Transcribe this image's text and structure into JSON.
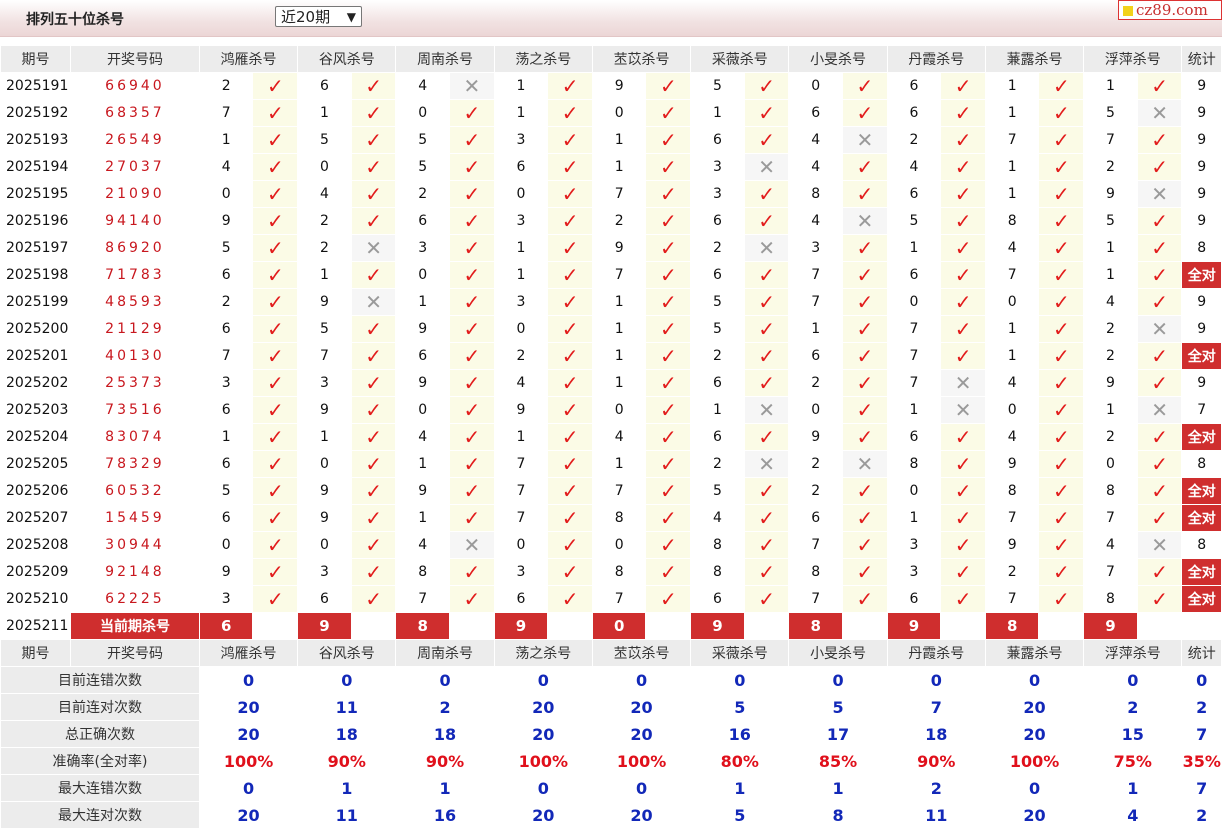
{
  "header": {
    "title": "排列五十位杀号",
    "period_select": "近20期",
    "logo_text": "cz89.com"
  },
  "columns": {
    "issue": "期号",
    "draw": "开奖号码",
    "experts": [
      "鸿雁杀号",
      "谷风杀号",
      "周南杀号",
      "荡之杀号",
      "苤苡杀号",
      "采薇杀号",
      "小旻杀号",
      "丹霞杀号",
      "蒹露杀号",
      "浮萍杀号"
    ],
    "count": "统计"
  },
  "rows": [
    {
      "issue": "2025191",
      "draw": "66940",
      "kills": [
        [
          2,
          1
        ],
        [
          6,
          1
        ],
        [
          4,
          0
        ],
        [
          1,
          1
        ],
        [
          9,
          1
        ],
        [
          5,
          1
        ],
        [
          0,
          1
        ],
        [
          6,
          1
        ],
        [
          1,
          1
        ],
        [
          1,
          1
        ]
      ],
      "count": "9"
    },
    {
      "issue": "2025192",
      "draw": "68357",
      "kills": [
        [
          7,
          1
        ],
        [
          1,
          1
        ],
        [
          0,
          1
        ],
        [
          1,
          1
        ],
        [
          0,
          1
        ],
        [
          1,
          1
        ],
        [
          6,
          1
        ],
        [
          6,
          1
        ],
        [
          1,
          1
        ],
        [
          5,
          0
        ]
      ],
      "count": "9"
    },
    {
      "issue": "2025193",
      "draw": "26549",
      "kills": [
        [
          1,
          1
        ],
        [
          5,
          1
        ],
        [
          5,
          1
        ],
        [
          3,
          1
        ],
        [
          1,
          1
        ],
        [
          6,
          1
        ],
        [
          4,
          0
        ],
        [
          2,
          1
        ],
        [
          7,
          1
        ],
        [
          7,
          1
        ]
      ],
      "count": "9"
    },
    {
      "issue": "2025194",
      "draw": "27037",
      "kills": [
        [
          4,
          1
        ],
        [
          0,
          1
        ],
        [
          5,
          1
        ],
        [
          6,
          1
        ],
        [
          1,
          1
        ],
        [
          3,
          0
        ],
        [
          4,
          1
        ],
        [
          4,
          1
        ],
        [
          1,
          1
        ],
        [
          2,
          1
        ]
      ],
      "count": "9"
    },
    {
      "issue": "2025195",
      "draw": "21090",
      "kills": [
        [
          0,
          1
        ],
        [
          4,
          1
        ],
        [
          2,
          1
        ],
        [
          0,
          1
        ],
        [
          7,
          1
        ],
        [
          3,
          1
        ],
        [
          8,
          1
        ],
        [
          6,
          1
        ],
        [
          1,
          1
        ],
        [
          9,
          0
        ]
      ],
      "count": "9"
    },
    {
      "issue": "2025196",
      "draw": "94140",
      "kills": [
        [
          9,
          1
        ],
        [
          2,
          1
        ],
        [
          6,
          1
        ],
        [
          3,
          1
        ],
        [
          2,
          1
        ],
        [
          6,
          1
        ],
        [
          4,
          0
        ],
        [
          5,
          1
        ],
        [
          8,
          1
        ],
        [
          5,
          1
        ]
      ],
      "count": "9"
    },
    {
      "issue": "2025197",
      "draw": "86920",
      "kills": [
        [
          5,
          1
        ],
        [
          2,
          0
        ],
        [
          3,
          1
        ],
        [
          1,
          1
        ],
        [
          9,
          1
        ],
        [
          2,
          0
        ],
        [
          3,
          1
        ],
        [
          1,
          1
        ],
        [
          4,
          1
        ],
        [
          1,
          1
        ]
      ],
      "count": "8"
    },
    {
      "issue": "2025198",
      "draw": "71783",
      "kills": [
        [
          6,
          1
        ],
        [
          1,
          1
        ],
        [
          0,
          1
        ],
        [
          1,
          1
        ],
        [
          7,
          1
        ],
        [
          6,
          1
        ],
        [
          7,
          1
        ],
        [
          6,
          1
        ],
        [
          7,
          1
        ],
        [
          1,
          1
        ]
      ],
      "count": "全对"
    },
    {
      "issue": "2025199",
      "draw": "48593",
      "kills": [
        [
          2,
          1
        ],
        [
          9,
          0
        ],
        [
          1,
          1
        ],
        [
          3,
          1
        ],
        [
          1,
          1
        ],
        [
          5,
          1
        ],
        [
          7,
          1
        ],
        [
          0,
          1
        ],
        [
          0,
          1
        ],
        [
          4,
          1
        ]
      ],
      "count": "9"
    },
    {
      "issue": "2025200",
      "draw": "21129",
      "kills": [
        [
          6,
          1
        ],
        [
          5,
          1
        ],
        [
          9,
          1
        ],
        [
          0,
          1
        ],
        [
          1,
          1
        ],
        [
          5,
          1
        ],
        [
          1,
          1
        ],
        [
          7,
          1
        ],
        [
          1,
          1
        ],
        [
          2,
          0
        ]
      ],
      "count": "9"
    },
    {
      "issue": "2025201",
      "draw": "40130",
      "kills": [
        [
          7,
          1
        ],
        [
          7,
          1
        ],
        [
          6,
          1
        ],
        [
          2,
          1
        ],
        [
          1,
          1
        ],
        [
          2,
          1
        ],
        [
          6,
          1
        ],
        [
          7,
          1
        ],
        [
          1,
          1
        ],
        [
          2,
          1
        ]
      ],
      "count": "全对"
    },
    {
      "issue": "2025202",
      "draw": "25373",
      "kills": [
        [
          3,
          1
        ],
        [
          3,
          1
        ],
        [
          9,
          1
        ],
        [
          4,
          1
        ],
        [
          1,
          1
        ],
        [
          6,
          1
        ],
        [
          2,
          1
        ],
        [
          7,
          0
        ],
        [
          4,
          1
        ],
        [
          9,
          1
        ]
      ],
      "count": "9"
    },
    {
      "issue": "2025203",
      "draw": "73516",
      "kills": [
        [
          6,
          1
        ],
        [
          9,
          1
        ],
        [
          0,
          1
        ],
        [
          9,
          1
        ],
        [
          0,
          1
        ],
        [
          1,
          0
        ],
        [
          0,
          1
        ],
        [
          1,
          0
        ],
        [
          0,
          1
        ],
        [
          1,
          0
        ]
      ],
      "count": "7"
    },
    {
      "issue": "2025204",
      "draw": "83074",
      "kills": [
        [
          1,
          1
        ],
        [
          1,
          1
        ],
        [
          4,
          1
        ],
        [
          1,
          1
        ],
        [
          4,
          1
        ],
        [
          6,
          1
        ],
        [
          9,
          1
        ],
        [
          6,
          1
        ],
        [
          4,
          1
        ],
        [
          2,
          1
        ]
      ],
      "count": "全对"
    },
    {
      "issue": "2025205",
      "draw": "78329",
      "kills": [
        [
          6,
          1
        ],
        [
          0,
          1
        ],
        [
          1,
          1
        ],
        [
          7,
          1
        ],
        [
          1,
          1
        ],
        [
          2,
          0
        ],
        [
          2,
          0
        ],
        [
          8,
          1
        ],
        [
          9,
          1
        ],
        [
          0,
          1
        ]
      ],
      "count": "8"
    },
    {
      "issue": "2025206",
      "draw": "60532",
      "kills": [
        [
          5,
          1
        ],
        [
          9,
          1
        ],
        [
          9,
          1
        ],
        [
          7,
          1
        ],
        [
          7,
          1
        ],
        [
          5,
          1
        ],
        [
          2,
          1
        ],
        [
          0,
          1
        ],
        [
          8,
          1
        ],
        [
          8,
          1
        ]
      ],
      "count": "全对"
    },
    {
      "issue": "2025207",
      "draw": "15459",
      "kills": [
        [
          6,
          1
        ],
        [
          9,
          1
        ],
        [
          1,
          1
        ],
        [
          7,
          1
        ],
        [
          8,
          1
        ],
        [
          4,
          1
        ],
        [
          6,
          1
        ],
        [
          1,
          1
        ],
        [
          7,
          1
        ],
        [
          7,
          1
        ]
      ],
      "count": "全对"
    },
    {
      "issue": "2025208",
      "draw": "30944",
      "kills": [
        [
          0,
          1
        ],
        [
          0,
          1
        ],
        [
          4,
          0
        ],
        [
          0,
          1
        ],
        [
          0,
          1
        ],
        [
          8,
          1
        ],
        [
          7,
          1
        ],
        [
          3,
          1
        ],
        [
          9,
          1
        ],
        [
          4,
          0
        ]
      ],
      "count": "8"
    },
    {
      "issue": "2025209",
      "draw": "92148",
      "kills": [
        [
          9,
          1
        ],
        [
          3,
          1
        ],
        [
          8,
          1
        ],
        [
          3,
          1
        ],
        [
          8,
          1
        ],
        [
          8,
          1
        ],
        [
          8,
          1
        ],
        [
          3,
          1
        ],
        [
          2,
          1
        ],
        [
          7,
          1
        ]
      ],
      "count": "全对"
    },
    {
      "issue": "2025210",
      "draw": "62225",
      "kills": [
        [
          3,
          1
        ],
        [
          6,
          1
        ],
        [
          7,
          1
        ],
        [
          6,
          1
        ],
        [
          7,
          1
        ],
        [
          6,
          1
        ],
        [
          7,
          1
        ],
        [
          6,
          1
        ],
        [
          7,
          1
        ],
        [
          8,
          1
        ]
      ],
      "count": "全对"
    }
  ],
  "current": {
    "issue": "2025211",
    "label": "当前期杀号",
    "kills": [
      "6",
      "9",
      "8",
      "9",
      "0",
      "9",
      "8",
      "9",
      "8",
      "9"
    ]
  },
  "stats": [
    {
      "label": "目前连错次数",
      "values": [
        "0",
        "0",
        "0",
        "0",
        "0",
        "0",
        "0",
        "0",
        "0",
        "0"
      ],
      "total": "0",
      "color": "blue"
    },
    {
      "label": "目前连对次数",
      "values": [
        "20",
        "11",
        "2",
        "20",
        "20",
        "5",
        "5",
        "7",
        "20",
        "2"
      ],
      "total": "2",
      "color": "blue"
    },
    {
      "label": "总正确次数",
      "values": [
        "20",
        "18",
        "18",
        "20",
        "20",
        "16",
        "17",
        "18",
        "20",
        "15"
      ],
      "total": "7",
      "color": "blue"
    },
    {
      "label": "准确率(全对率)",
      "values": [
        "100%",
        "90%",
        "90%",
        "100%",
        "100%",
        "80%",
        "85%",
        "90%",
        "100%",
        "75%"
      ],
      "total": "35%",
      "color": "red"
    },
    {
      "label": "最大连错次数",
      "values": [
        "0",
        "1",
        "1",
        "0",
        "0",
        "1",
        "1",
        "2",
        "0",
        "1"
      ],
      "total": "7",
      "color": "blue"
    },
    {
      "label": "最大连对次数",
      "values": [
        "20",
        "11",
        "16",
        "20",
        "20",
        "5",
        "8",
        "11",
        "20",
        "4"
      ],
      "total": "2",
      "color": "blue"
    }
  ],
  "colors": {
    "accent_red": "#cf2e2e",
    "check_red": "#e21c1c",
    "stat_blue": "#1228b8"
  }
}
